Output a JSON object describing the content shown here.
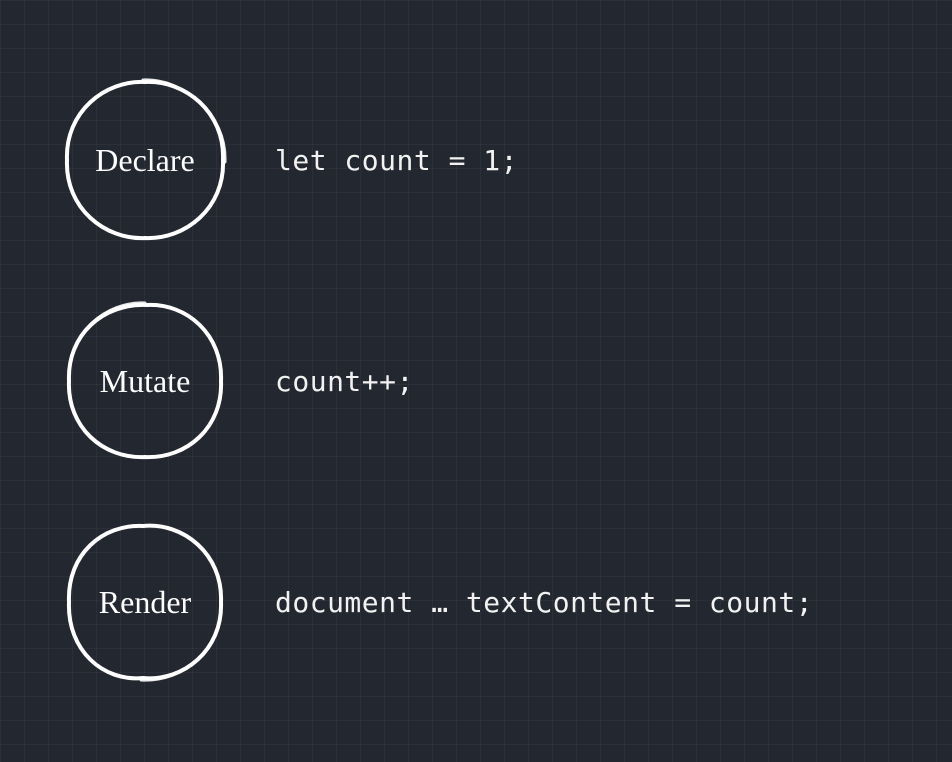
{
  "diagram": {
    "colors": {
      "background": "#23272f",
      "stroke": "#ffffff",
      "text": "#f2f2f2"
    },
    "rows": [
      {
        "label": "Declare",
        "code": "let count = 1;"
      },
      {
        "label": "Mutate",
        "code": "count++;"
      },
      {
        "label": "Render",
        "code": "document … textContent = count;"
      }
    ]
  }
}
